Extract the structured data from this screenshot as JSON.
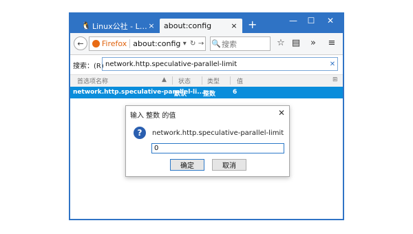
{
  "tabs": [
    {
      "label": "Linux公社 - Linux...",
      "icon": "penguin-icon",
      "close": "×"
    },
    {
      "label": "about:config",
      "close": "×"
    }
  ],
  "new_tab": "+",
  "window_controls": {
    "minimize": "—",
    "maximize": "☐",
    "close": "✕"
  },
  "navbar": {
    "identity": "Firefox",
    "url": "about:config",
    "search_placeholder": "搜索",
    "icons": {
      "bookmark": "☆",
      "reader": "▤",
      "overflow": "»",
      "menu": "≡"
    }
  },
  "filter": {
    "label": "搜索：(R)",
    "value": "network.http.speculative-parallel-limit",
    "clear": "✕"
  },
  "columns": [
    "首选项名称",
    "状态",
    "类型",
    "值"
  ],
  "rows": [
    {
      "name": "network.http.speculative-parallel-li...",
      "status": "默认",
      "type": "整数",
      "value": "6"
    }
  ],
  "dialog": {
    "title": "输入 整数 的值",
    "close": "✕",
    "icon": "?",
    "prompt": "network.http.speculative-parallel-limit",
    "input_value": "0",
    "ok_label": "确定",
    "cancel_label": "取消"
  },
  "colors": {
    "chrome_blue": "#2f73c5",
    "selected_row": "#0a8ddb",
    "firefox_orange": "#e0620c"
  }
}
